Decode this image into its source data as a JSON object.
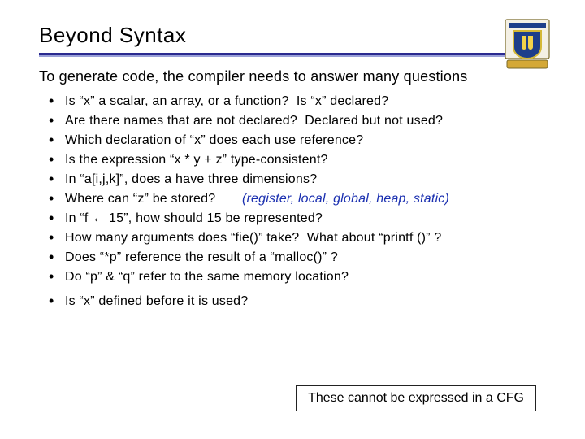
{
  "title": "Beyond Syntax",
  "intro": "To generate code, the compiler needs to answer many questions",
  "bullets": {
    "b0": "Is “x” a scalar, an array, or a function?  Is “x” declared?",
    "b1": "Are there names that are not declared?  Declared but not used?",
    "b2": "Which declaration of “x” does each use reference?",
    "b3": "Is the expression “x * y + z” type-consistent?",
    "b4": "In “a[i,j,k]”, does a have three dimensions?",
    "b5a": "Where can “z” be stored?",
    "b5b": "(register, local, global, heap, static)",
    "b6": "In “f ← 15”, how should 15 be represented?",
    "b7": "How many arguments does “fie()” take?  What about “printf ()” ?",
    "b8": "Does “*p” reference the result of a “malloc()” ?",
    "b9": "Do “p” & “q” refer to the same memory location?",
    "b10": "Is “x” defined before it is used?"
  },
  "note": "These cannot be expressed in a CFG",
  "logo_alt": "University of Delaware crest"
}
